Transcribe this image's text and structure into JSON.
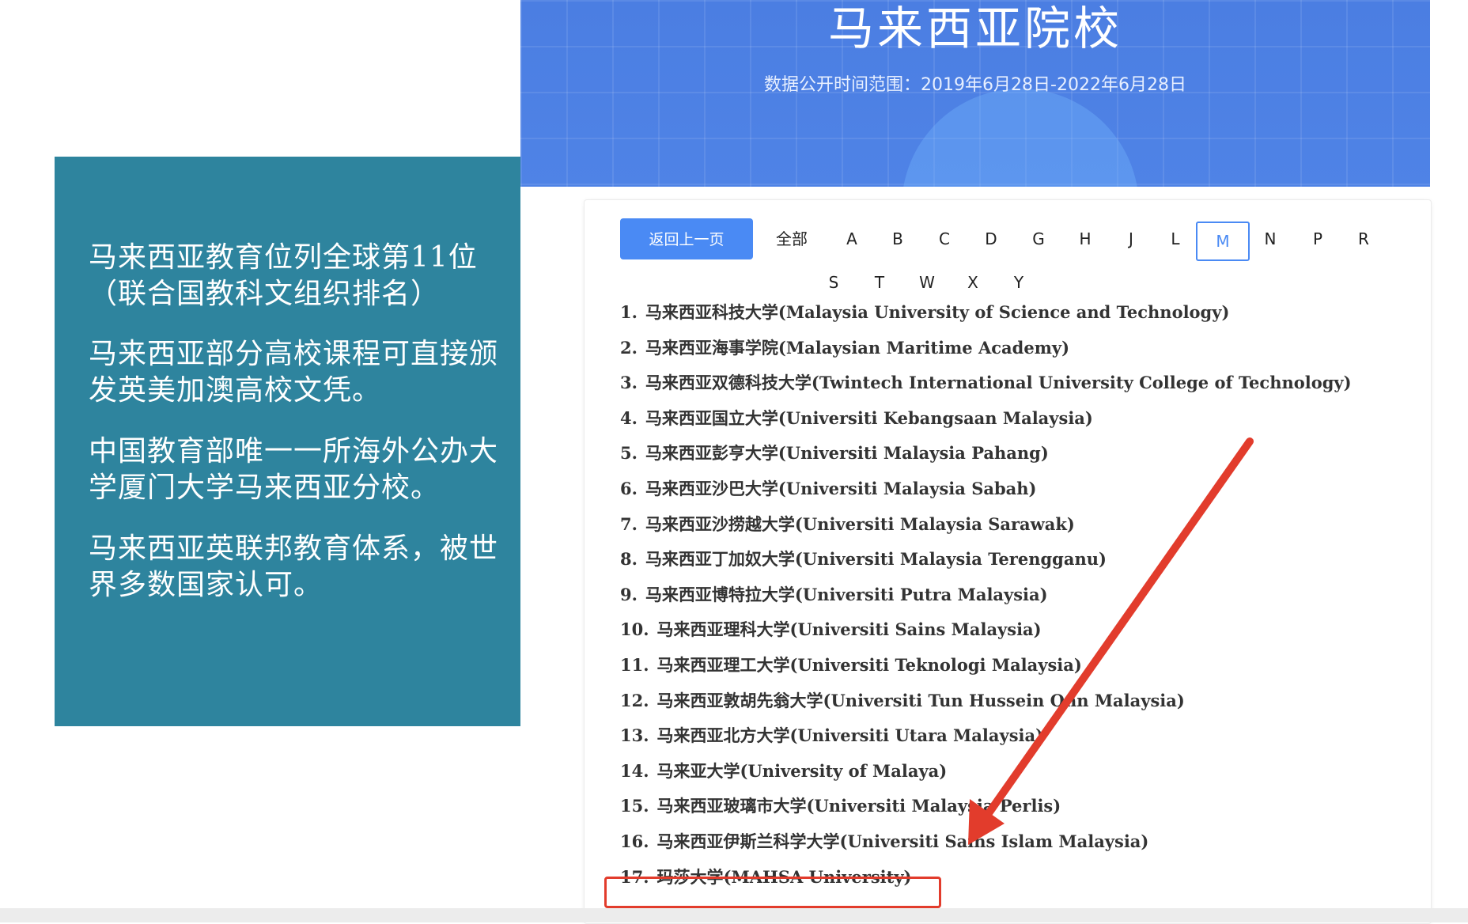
{
  "left_panel": {
    "paragraphs": [
      "马来西亚教育位列全球第11位（联合国教科文组织排名）",
      "马来西亚部分高校课程可直接颁发英美加澳高校文凭。",
      "中国教育部唯一一所海外公办大学厦门大学马来西亚分校。",
      "马来西亚英联邦教育体系，被世界多数国家认可。"
    ],
    "background_color": "#2e849e"
  },
  "banner": {
    "title": "马来西亚院校",
    "subtitle": "数据公开时间范围：2019年6月28日-2022年6月28日"
  },
  "filter": {
    "back_label": "返回上一页",
    "all_label": "全部",
    "letters": [
      "A",
      "B",
      "C",
      "D",
      "G",
      "H",
      "J",
      "L",
      "M",
      "N",
      "P",
      "R",
      "S",
      "T",
      "W",
      "X",
      "Y"
    ],
    "active_letter": "M"
  },
  "universities": [
    {
      "num": "1.",
      "name": "马来西亚科技大学(Malaysia University of Science and Technology)"
    },
    {
      "num": "2.",
      "name": "马来西亚海事学院(Malaysian Maritime Academy)"
    },
    {
      "num": "3.",
      "name": "马来西亚双德科技大学(Twintech International University College of Technology)"
    },
    {
      "num": "4.",
      "name": "马来西亚国立大学(Universiti Kebangsaan Malaysia)"
    },
    {
      "num": "5.",
      "name": "马来西亚彭亨大学(Universiti Malaysia Pahang)"
    },
    {
      "num": "6.",
      "name": "马来西亚沙巴大学(Universiti Malaysia Sabah)"
    },
    {
      "num": "7.",
      "name": "马来西亚沙捞越大学(Universiti Malaysia Sarawak)"
    },
    {
      "num": "8.",
      "name": "马来西亚丁加奴大学(Universiti Malaysia Terengganu)"
    },
    {
      "num": "9.",
      "name": "马来西亚博特拉大学(Universiti Putra Malaysia)"
    },
    {
      "num": "10.",
      "name": "马来西亚理科大学(Universiti Sains Malaysia)"
    },
    {
      "num": "11.",
      "name": "马来西亚理工大学(Universiti Teknologi Malaysia)"
    },
    {
      "num": "12.",
      "name": "马来西亚敦胡先翁大学(Universiti Tun Hussein Onn Malaysia)"
    },
    {
      "num": "13.",
      "name": "马来西亚北方大学(Universiti Utara Malaysia)"
    },
    {
      "num": "14.",
      "name": "马来亚大学(University of Malaya)"
    },
    {
      "num": "15.",
      "name": "马来西亚玻璃市大学(Universiti Malaysia Perlis)"
    },
    {
      "num": "16.",
      "name": "马来西亚伊斯兰科学大学(Universiti Sains Islam Malaysia)"
    },
    {
      "num": "17.",
      "name": "玛莎大学(MAHSA University)"
    }
  ],
  "highlighted_item": "17.",
  "colors": {
    "accent": "#4a8af4",
    "annotation_red": "#e23c2c",
    "banner_blue": "#4a7fe0"
  }
}
